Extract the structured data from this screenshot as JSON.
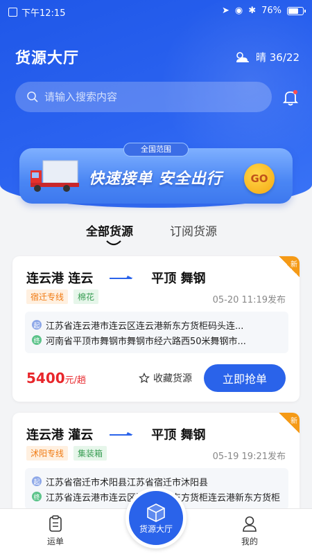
{
  "status_bar": {
    "time": "下午12:15",
    "battery": "76%",
    "battery_level": 0.76
  },
  "header": {
    "title": "货源大厅",
    "weather_text": "晴 36/22"
  },
  "search": {
    "placeholder": "请输入搜索内容"
  },
  "banner": {
    "tag": "全国范围",
    "slogan": "快速接单  安全出行",
    "go_label": "GO"
  },
  "tabs": [
    {
      "label": "全部货源"
    },
    {
      "label": "订阅货源"
    }
  ],
  "cards": [
    {
      "from_city": "连云港",
      "from_district": "连云",
      "to_city": "平顶",
      "to_district": "舞钢",
      "badge": "新",
      "tags": [
        "宿迁专线",
        "棉花"
      ],
      "time": "05-20 11:19发布",
      "start_marker": "起",
      "end_marker": "终",
      "start_address": "江苏省连云港市连云区连云港新东方货柜码头连...",
      "end_address": "河南省平顶市舞钢市舞钢市经六路西50米舞钢市...",
      "price": "5400",
      "price_unit": "元/趟",
      "collect_label": "收藏货源",
      "grab_label": "立即抢单"
    },
    {
      "from_city": "连云港",
      "from_district": "灌云",
      "to_city": "平顶",
      "to_district": "舞钢",
      "badge": "新",
      "tags": [
        "沭阳专线",
        "集装箱"
      ],
      "time": "05-19 19:21发布",
      "start_marker": "起",
      "end_marker": "终",
      "start_address": "江苏省宿迁市术阳县江苏省宿迁市沐阳县",
      "end_address": "江苏省连云港市连云区连云港新东方货柜连云港新东方货柜"
    }
  ],
  "tabbar": {
    "waybill": "运单",
    "center": "货源大厅",
    "mine": "我的"
  },
  "colors": {
    "primary": "#2a63ea",
    "price": "#e8262b",
    "badge": "#f59a16"
  }
}
